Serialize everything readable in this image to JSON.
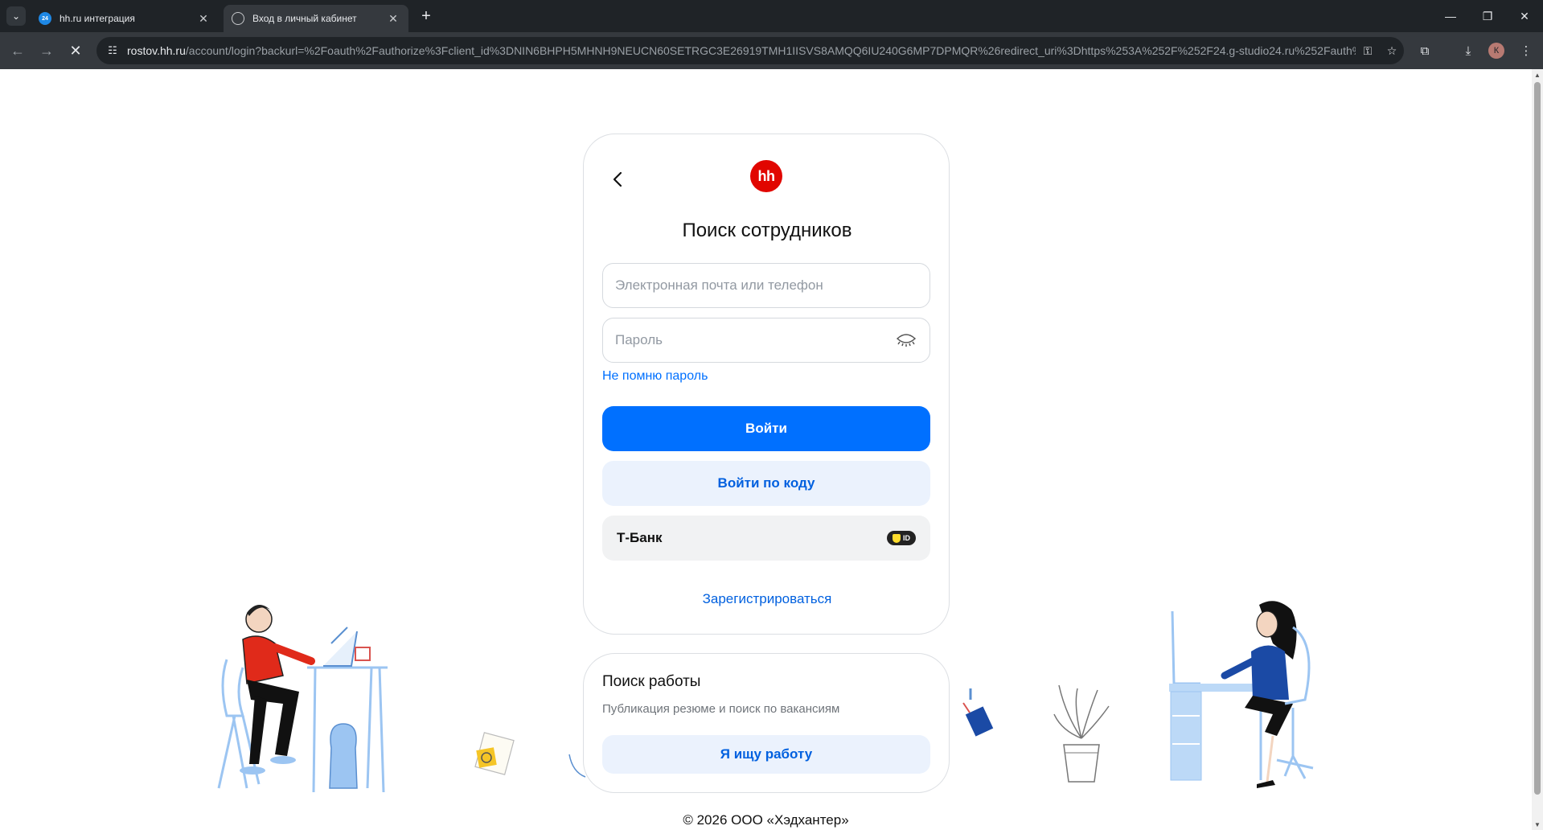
{
  "browser": {
    "tabs": [
      {
        "title": "hh.ru интеграция",
        "favicon_text": "24",
        "active": false
      },
      {
        "title": "Вход в личный кабинет",
        "active": true
      }
    ],
    "address": {
      "host": "rostov.hh.ru",
      "path": "/account/login?backurl=%2Foauth%2Fauthorize%3Fclient_id%3DNIN6BHPH5MHNH9NEUCN60SETRGC3E26919TMH1IISVS8AMQQ6IU240G6MP7DPMQR%26redirect_uri%3Dhttps%253A%252F%252F24.g-studio24.ru%252Fauth%25..."
    },
    "profile_initial": "К"
  },
  "login": {
    "title": "Поиск сотрудников",
    "logo_text": "hh",
    "email_placeholder": "Электронная почта или телефон",
    "password_placeholder": "Пароль",
    "forgot_password": "Не помню пароль",
    "submit_label": "Войти",
    "code_login_label": "Войти по коду",
    "tbank_label": "Т-Банк",
    "tbank_badge": "ID",
    "register_label": "Зарегистрироваться"
  },
  "job_search": {
    "title": "Поиск работы",
    "subtitle": "Публикация резюме и поиск по вакансиям",
    "button_label": "Я ищу работу"
  },
  "footer": {
    "copyright": "© 2026 ООО «Хэдхантер»"
  },
  "colors": {
    "primary": "#0070ff",
    "brand_red": "#e10600",
    "secondary_bg": "#ebf2fd",
    "tbank_yellow": "#ffdd2d"
  },
  "icons": [
    "tab-list-icon",
    "close-icon",
    "plus-icon",
    "minimize-icon",
    "restore-icon",
    "back-arrow-icon",
    "forward-arrow-icon",
    "stop-loading-icon",
    "site-info-icon",
    "password-key-icon",
    "star-icon",
    "extensions-icon",
    "download-icon",
    "menu-icon",
    "chevron-left-icon",
    "eye-closed-icon",
    "shield-icon"
  ]
}
